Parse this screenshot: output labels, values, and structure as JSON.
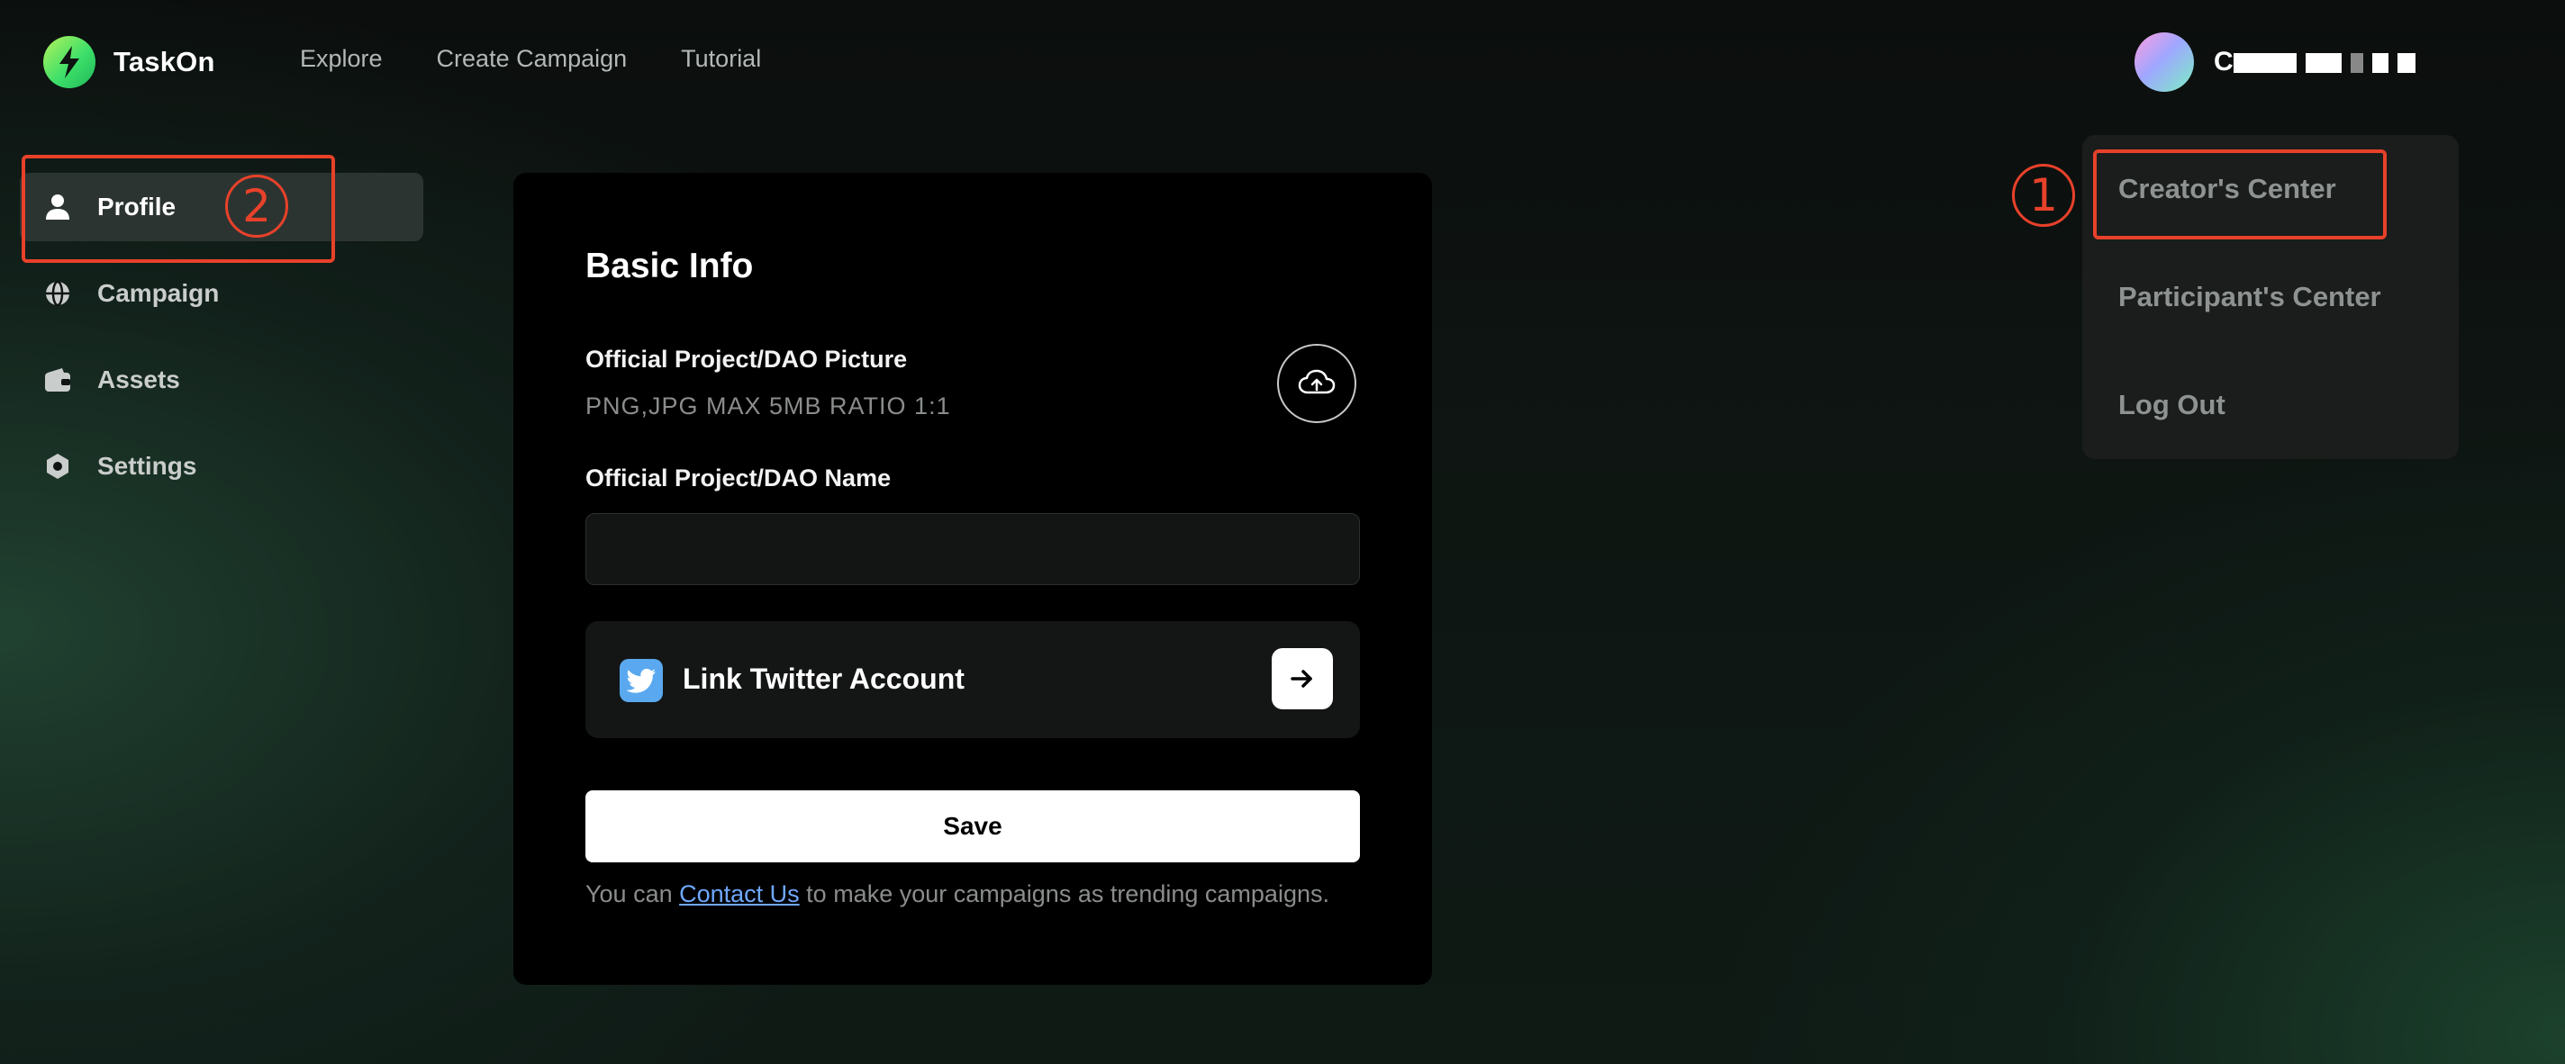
{
  "header": {
    "logo_text": "TaskOn",
    "nav": [
      "Explore",
      "Create Campaign",
      "Tutorial"
    ],
    "user_name_initial": "C"
  },
  "dropdown": {
    "items": [
      "Creator's Center",
      "Participant's Center",
      "Log Out"
    ]
  },
  "sidebar": {
    "items": [
      {
        "label": "Profile",
        "icon": "user-icon",
        "active": true
      },
      {
        "label": "Campaign",
        "icon": "globe-icon",
        "active": false
      },
      {
        "label": "Assets",
        "icon": "wallet-icon",
        "active": false
      },
      {
        "label": "Settings",
        "icon": "gear-icon",
        "active": false
      }
    ]
  },
  "main": {
    "title": "Basic Info",
    "picture_label": "Official Project/DAO Picture",
    "picture_hint": "PNG,JPG MAX 5MB RATIO 1:1",
    "name_label": "Official Project/DAO Name",
    "name_value": "",
    "twitter_label": "Link Twitter Account",
    "save_label": "Save",
    "footnote_prefix": "You can ",
    "footnote_link": "Contact Us",
    "footnote_suffix": " to make your campaigns as trending campaigns."
  },
  "annotations": {
    "step1": "1",
    "step2": "2"
  },
  "colors": {
    "annotation": "#e8412a",
    "link": "#6fa8ff",
    "accent": "#3ee06a"
  }
}
